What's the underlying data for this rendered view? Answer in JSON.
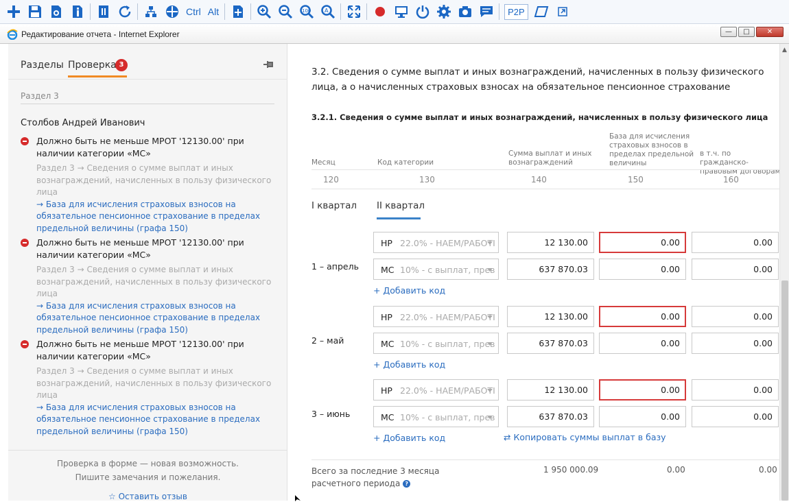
{
  "toolbar": {
    "ctrl_label": "Ctrl",
    "alt_label": "Alt",
    "p2p_label": "P2P"
  },
  "window": {
    "title": "Редактирование отчета - Internet Explorer",
    "min": "—",
    "max": "□",
    "close": "✕"
  },
  "left_panel": {
    "tab_sections": "Разделы",
    "tab_check": "Проверка",
    "badge_count": "3",
    "section_label": "Раздел 3",
    "person": "Столбов Андрей Иванович",
    "errors": [
      {
        "message": "Должно быть не меньше МРОТ '12130.00' при наличии категории «МС»",
        "path": "Раздел 3 → Сведения о сумме выплат и иных вознаграждений, начисленных в пользу физического лица",
        "link": "→ База для исчисления страховых взносов на обязательное пенсионное страхование в пределах предельной величины (графа 150)"
      },
      {
        "message": "Должно быть не меньше МРОТ '12130.00' при наличии категории «МС»",
        "path": "Раздел 3 → Сведения о сумме выплат и иных вознаграждений, начисленных в пользу физического лица",
        "link": "→ База для исчисления страховых взносов на обязательное пенсионное страхование в пределах предельной величины (графа 150)"
      },
      {
        "message": "Должно быть не меньше МРОТ '12130.00' при наличии категории «МС»",
        "path": "Раздел 3 → Сведения о сумме выплат и иных вознаграждений, начисленных в пользу физического лица",
        "link": "→ База для исчисления страховых взносов на обязательное пенсионное страхование в пределах предельной величины (графа 150)"
      }
    ],
    "footer_line1": "Проверка в форме — новая возможность.",
    "footer_line2": "Пишите замечания и пожелания.",
    "feedback_link": "☆ Оставить отзыв"
  },
  "main": {
    "title": "3.2. Сведения о сумме выплат и иных вознаграждений, начисленных в пользу физического лица, а о начисленных страховых взносах на обязательное пенсионное страхование",
    "subtitle": "3.2.1. Сведения о сумме выплат и иных вознаграждений, начисленных в пользу физического лица",
    "columns": [
      {
        "label": "Месяц",
        "num": "120"
      },
      {
        "label": "Код категории",
        "num": "130"
      },
      {
        "label": "Сумма выплат и иных вознаграждений",
        "num": "140"
      },
      {
        "label": "База для исчисления страховых взносов в пределах предельной величины",
        "num": "150"
      },
      {
        "label": "в т.ч. по гражданско-правовым договорам",
        "num": "160"
      }
    ],
    "quarter_tabs": [
      "I квартал",
      "II квартал"
    ],
    "months": [
      {
        "name": "1 – апрель",
        "rows": [
          {
            "code": "НР",
            "desc": "22.0% - НАЕМ/РАБОТІ",
            "sum": "12 130.00",
            "base": "0.00",
            "gpd": "0.00"
          },
          {
            "code": "МС",
            "desc": "10% - с выплат, прев",
            "sum": "637 870.03",
            "base": "0.00",
            "gpd": "0.00"
          }
        ],
        "add_code": "+ Добавить код"
      },
      {
        "name": "2 – май",
        "rows": [
          {
            "code": "НР",
            "desc": "22.0% - НАЕМ/РАБОТІ",
            "sum": "12 130.00",
            "base": "0.00",
            "gpd": "0.00"
          },
          {
            "code": "МС",
            "desc": "10% - с выплат, прев",
            "sum": "637 870.03",
            "base": "0.00",
            "gpd": "0.00"
          }
        ],
        "add_code": "+ Добавить код"
      },
      {
        "name": "3 – июнь",
        "rows": [
          {
            "code": "НР",
            "desc": "22.0% - НАЕМ/РАБОТІ",
            "sum": "12 130.00",
            "base": "0.00",
            "gpd": "0.00"
          },
          {
            "code": "МС",
            "desc": "10% - с выплат, прев",
            "sum": "637 870.03",
            "base": "0.00",
            "gpd": "0.00"
          }
        ],
        "add_code": "+ Добавить код"
      }
    ],
    "copy_link": "⇄ Копировать суммы выплат в базу",
    "total_label_1": "Всего за последние 3 месяца",
    "total_label_2": "расчетного периода",
    "total_sum": "1 950 000.09",
    "total_base": "0.00",
    "total_gpd": "0.00",
    "colors": {
      "accent": "#f08a24",
      "link": "#2a6cbf",
      "error": "#d62b2b",
      "toolbar_icon": "#1b67c4"
    }
  }
}
